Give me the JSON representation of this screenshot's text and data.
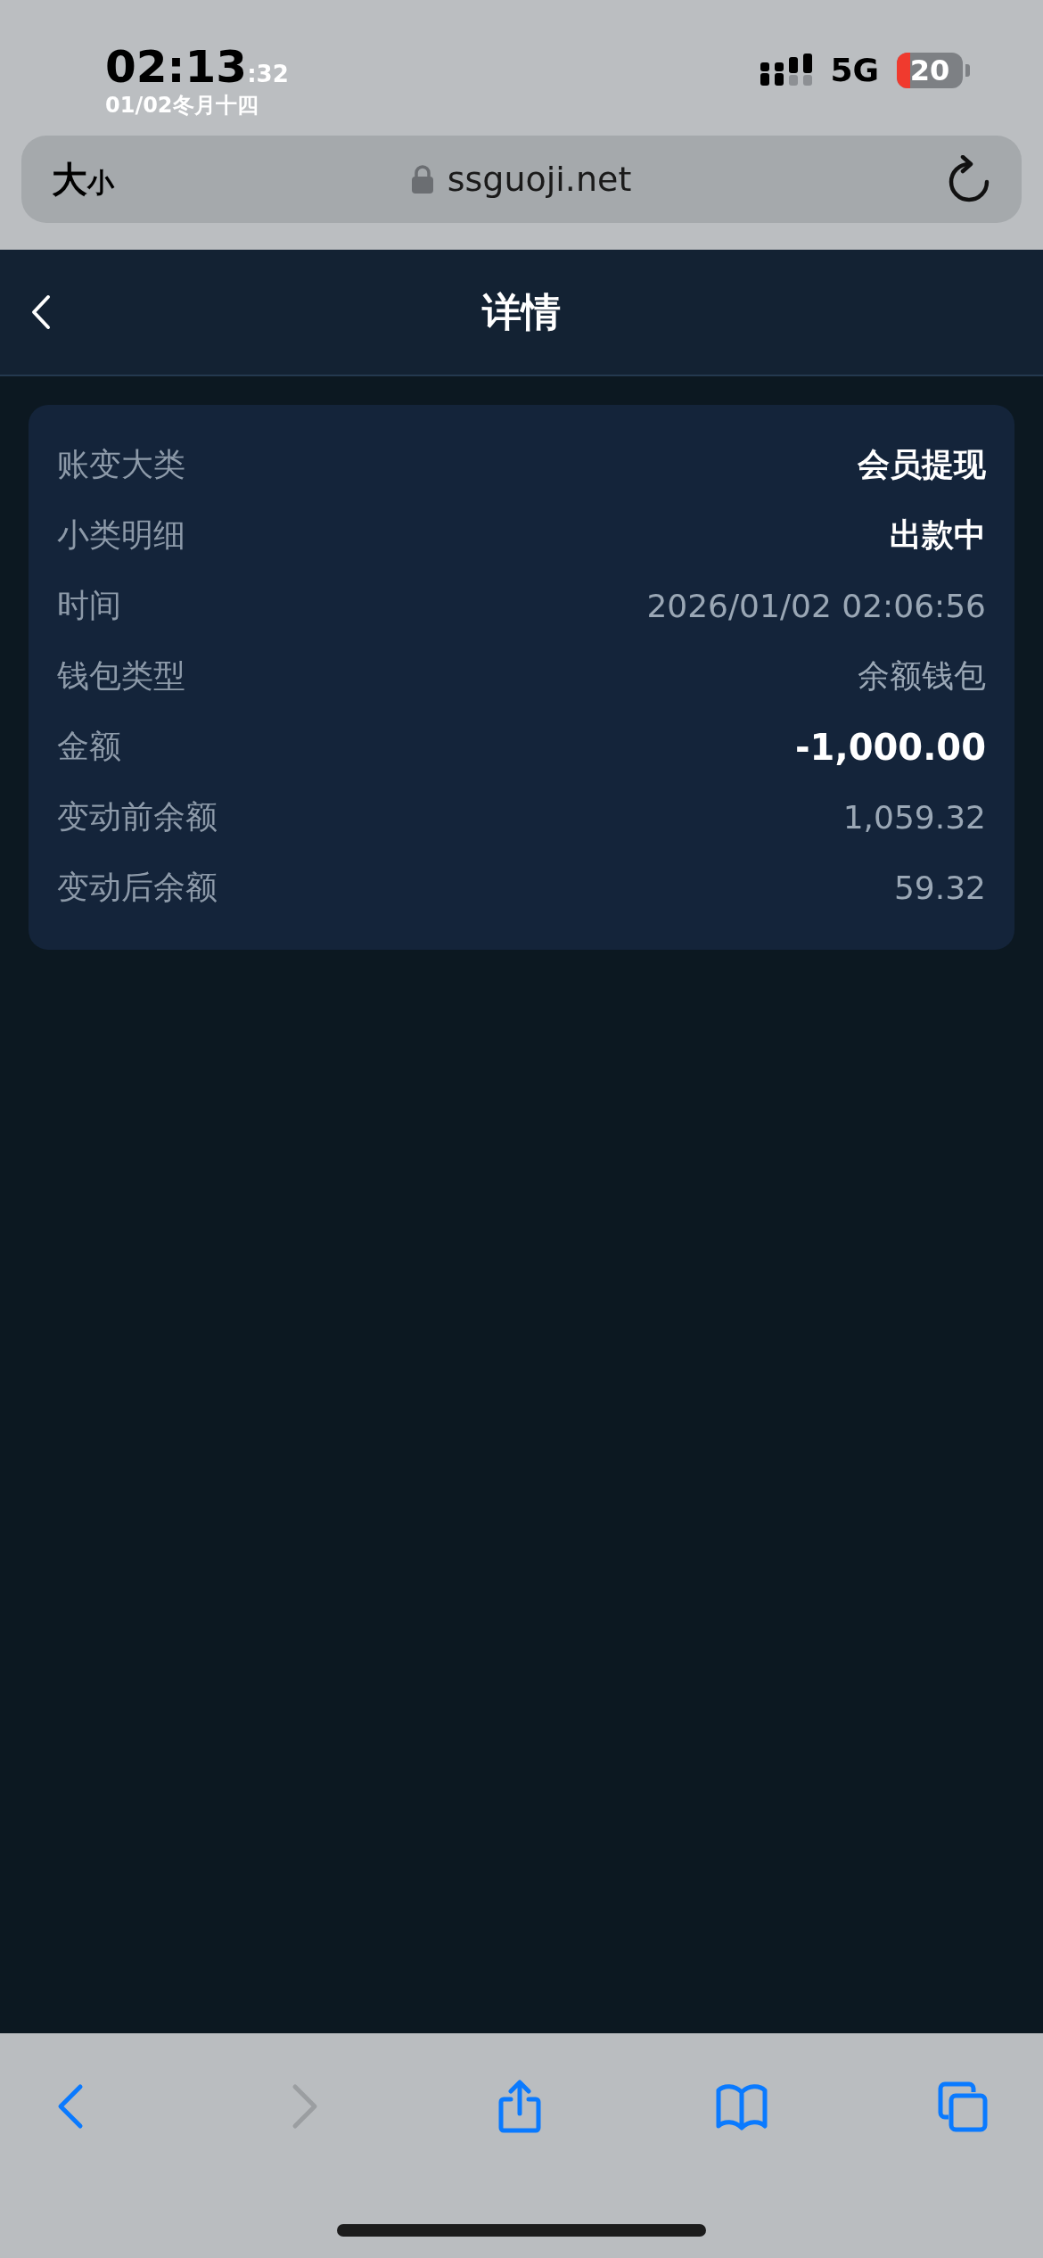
{
  "status_bar": {
    "time": "02:13",
    "seconds": ":32",
    "date": "01/02冬月十四",
    "network": "5G",
    "battery": "20"
  },
  "address_bar": {
    "text_size_large": "大",
    "text_size_small": "小",
    "url": "ssguoji.net"
  },
  "header": {
    "title": "详情"
  },
  "details": [
    {
      "label": "账变大类",
      "value": "会员提现",
      "kind": "strong"
    },
    {
      "label": "小类明细",
      "value": "出款中",
      "kind": "strong"
    },
    {
      "label": "时间",
      "value": "2026/01/02 02:06:56",
      "kind": "muted"
    },
    {
      "label": "钱包类型",
      "value": "余额钱包",
      "kind": "muted"
    },
    {
      "label": "金额",
      "value": "-1,000.00",
      "kind": "amount"
    },
    {
      "label": "变动前余额",
      "value": "1,059.32",
      "kind": "muted"
    },
    {
      "label": "变动后余额",
      "value": "59.32",
      "kind": "muted"
    }
  ],
  "toolbar": [
    {
      "kind": "back",
      "disabled": false
    },
    {
      "kind": "forward",
      "disabled": true
    },
    {
      "kind": "share",
      "disabled": false
    },
    {
      "kind": "bookmarks",
      "disabled": false
    },
    {
      "kind": "tabs",
      "disabled": false
    }
  ]
}
